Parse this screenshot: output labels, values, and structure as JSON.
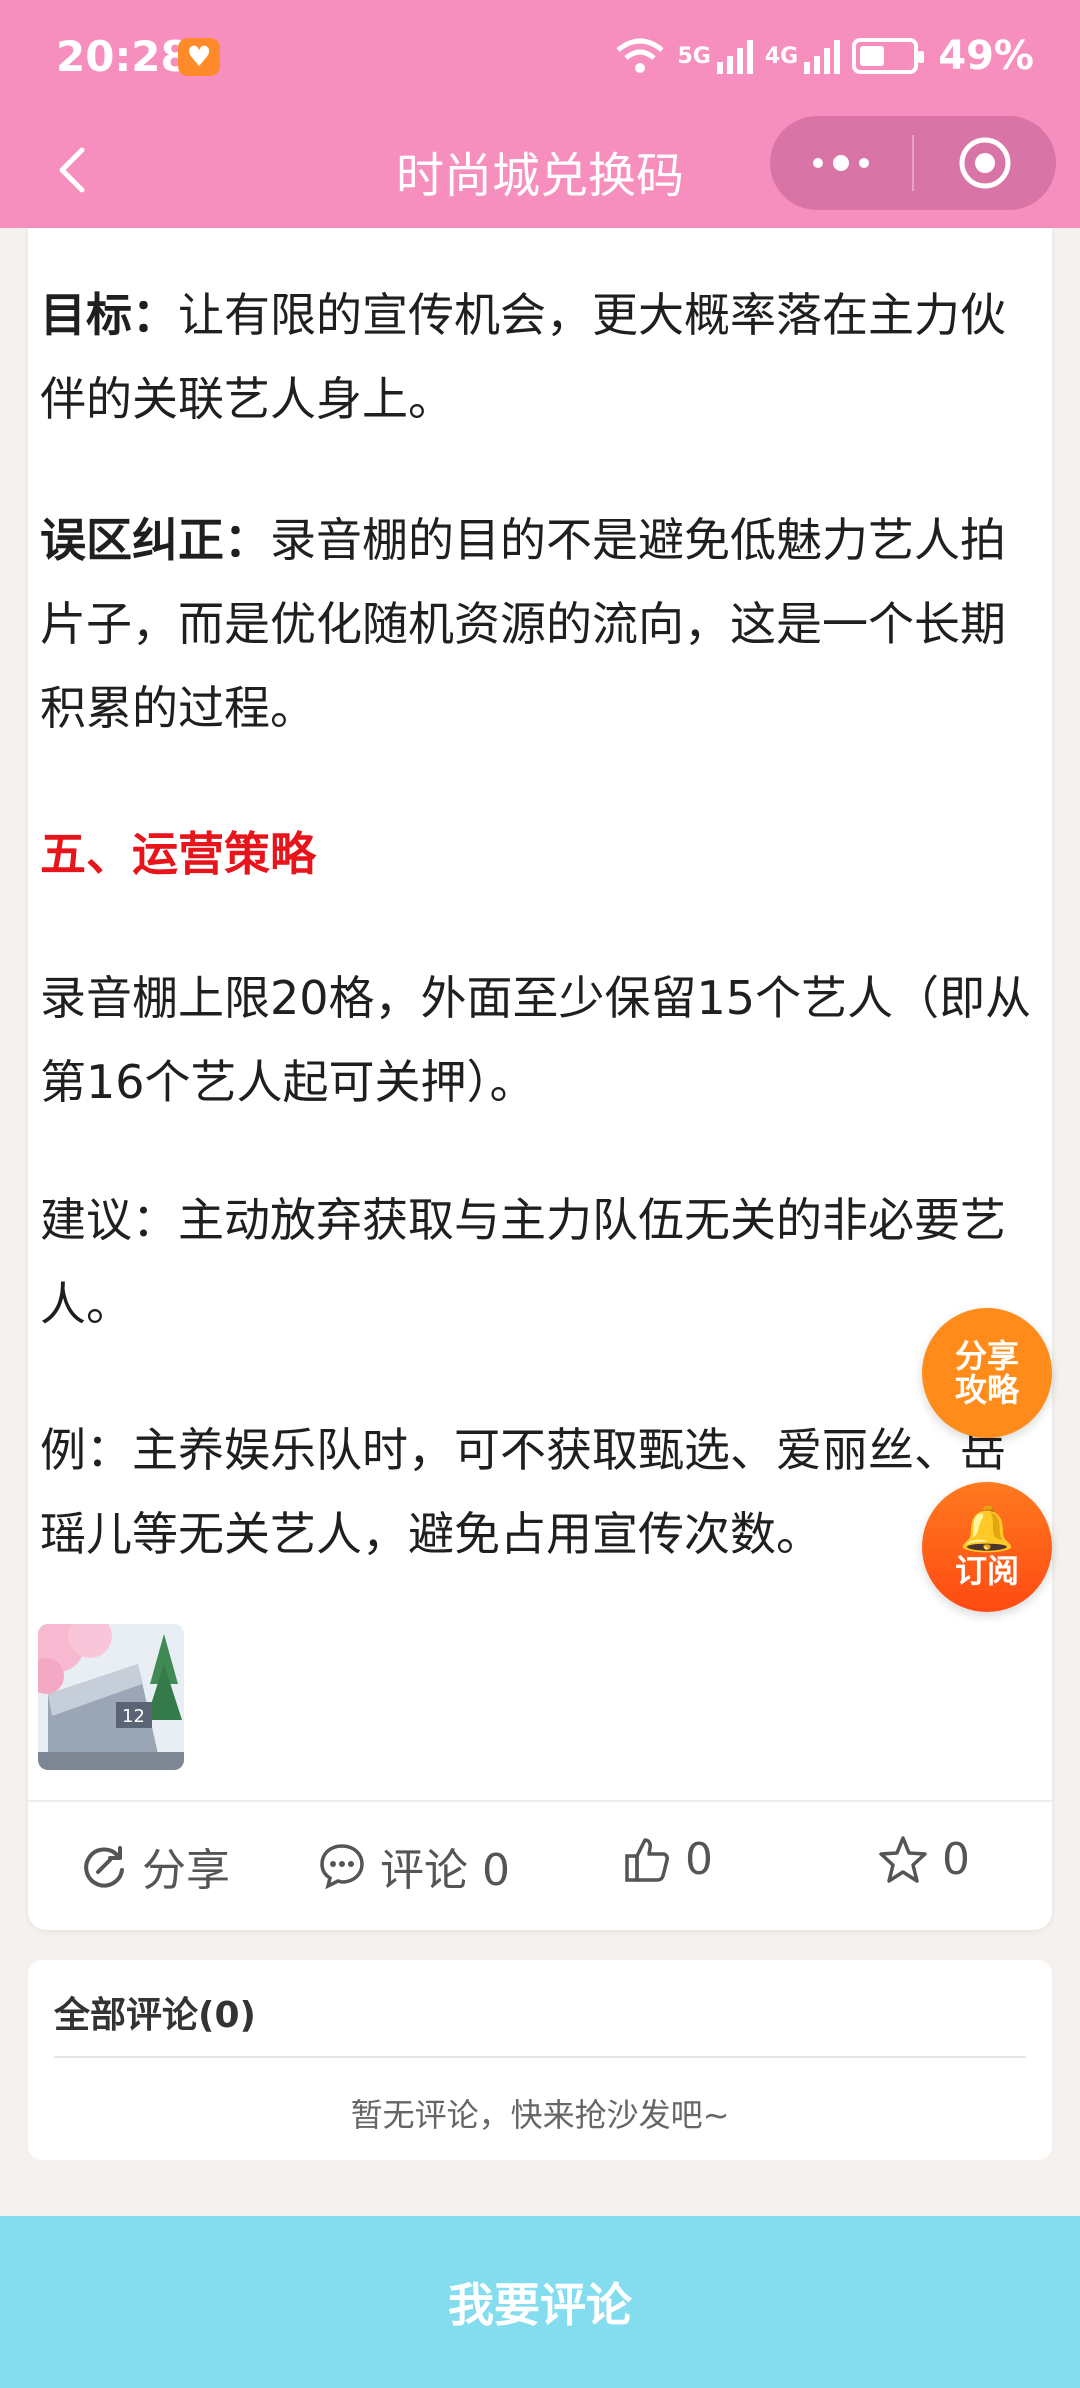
{
  "status_bar": {
    "time": "20:28",
    "network_5g": "5G",
    "network_4g": "4G",
    "battery": "49%"
  },
  "nav": {
    "title": "时尚城兑换码"
  },
  "article": {
    "p1_label": "目标：",
    "p1_text": "让有限的宣传机会，更大概率落在主力伙伴的关联艺人身上。",
    "p2_label": "误区纠正：",
    "p2_text": "录音棚的目的不是避免低魅力艺人拍片子，而是优化随机资源的流向，这是一个长期积累的过程。",
    "section_title": "五、运营策略",
    "p3": "录音棚上限20格，外面至少保留15个艺人（即从第16个艺人起可关押）。",
    "p4": "建议：主动放弃获取与主力队伍无关的非必要艺人。",
    "p5": "例：主养娱乐队时，可不获取甄选、爱丽丝、岳瑶儿等无关艺人，避免占用宣传次数。"
  },
  "actions": {
    "share": "分享",
    "comment": "评论 0",
    "like": "0",
    "favorite": "0"
  },
  "float": {
    "share_line1": "分享",
    "share_line2": "攻略",
    "subscribe": "订阅"
  },
  "comments": {
    "title": "全部评论(0)",
    "empty": "暂无评论，快来抢沙发吧~"
  },
  "bottom": {
    "comment_button": "我要评论"
  }
}
